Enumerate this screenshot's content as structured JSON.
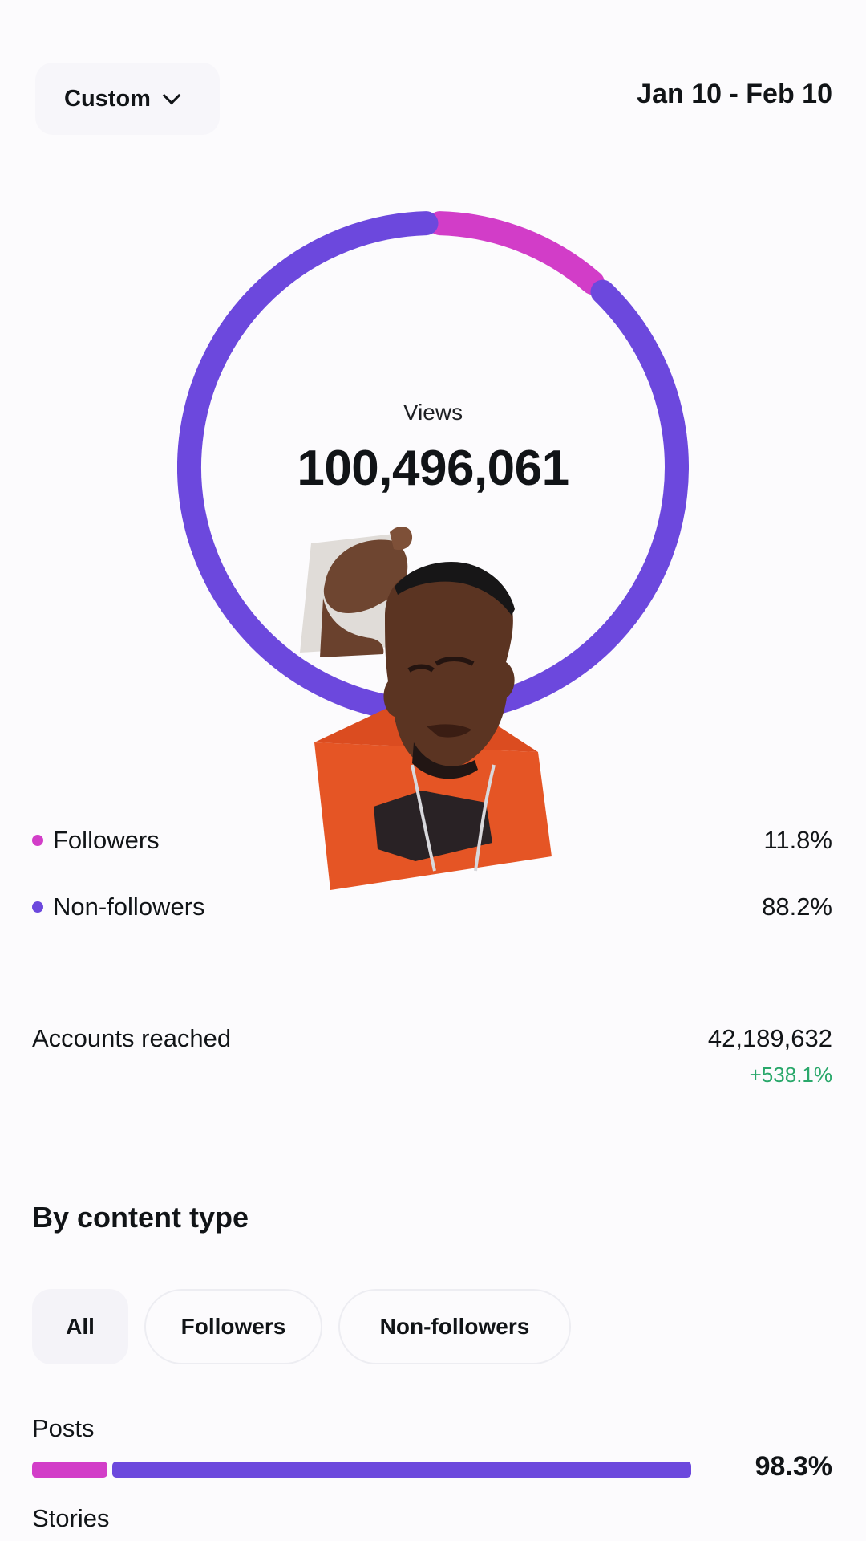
{
  "header": {
    "range_label": "Custom",
    "date_range": "Jan 10 - Feb 10"
  },
  "colors": {
    "followers": "#d23dc8",
    "non_followers": "#6c48dd",
    "positive_change": "#2aa86b"
  },
  "views": {
    "label": "Views",
    "value": "100,496,061",
    "followers_fraction": 0.118,
    "non_followers_fraction": 0.882
  },
  "legend": [
    {
      "label": "Followers",
      "value": "11.8%",
      "color": "#d23dc8"
    },
    {
      "label": "Non-followers",
      "value": "88.2%",
      "color": "#6c48dd"
    }
  ],
  "accounts_reached": {
    "label": "Accounts reached",
    "value": "42,189,632",
    "change": "+538.1%"
  },
  "content_type": {
    "title": "By content type",
    "filters": [
      {
        "label": "All",
        "selected": true
      },
      {
        "label": "Followers",
        "selected": false
      },
      {
        "label": "Non-followers",
        "selected": false
      }
    ],
    "rows": [
      {
        "label": "Posts",
        "value": "98.3%",
        "total_fraction": 0.983,
        "followers_fraction": 0.118
      },
      {
        "label": "Stories"
      }
    ]
  },
  "overlay": {
    "icon": "person-photo-icon"
  }
}
